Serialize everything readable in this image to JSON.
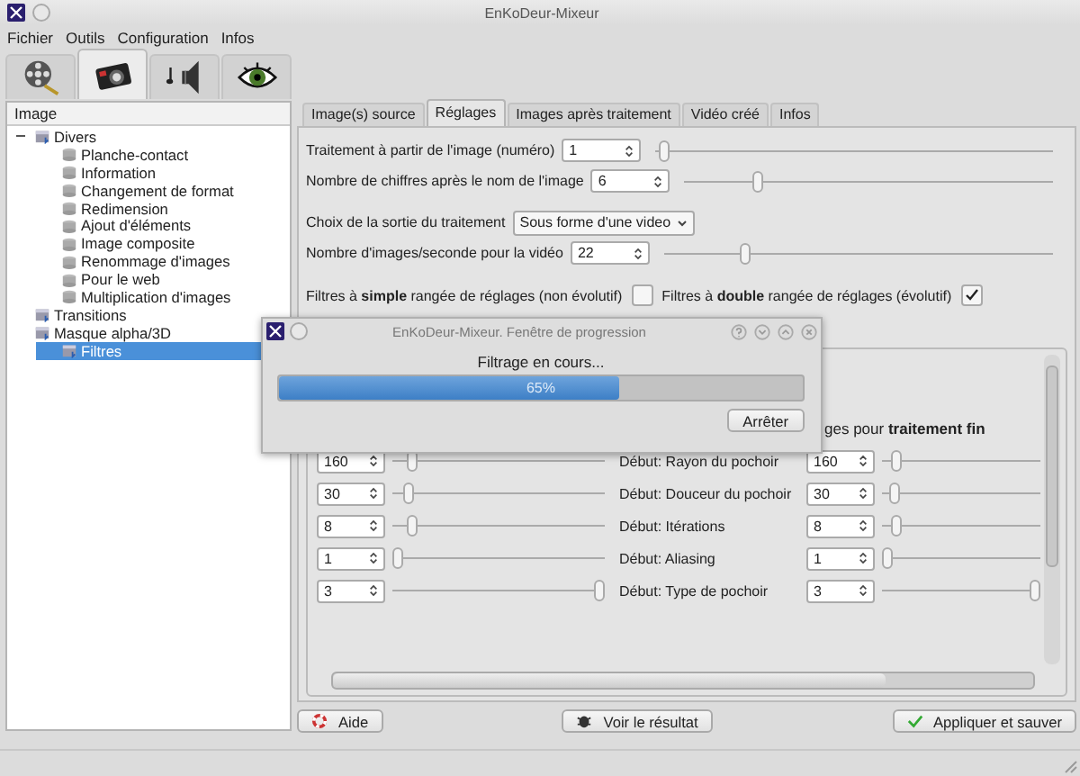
{
  "window": {
    "title": "EnKoDeur-Mixeur"
  },
  "menu": [
    "Fichier",
    "Outils",
    "Configuration",
    "Infos"
  ],
  "toolbar_tabs": [
    {
      "kind": "film",
      "selected": false
    },
    {
      "kind": "camera",
      "selected": true
    },
    {
      "kind": "speaker",
      "selected": false
    },
    {
      "kind": "eye",
      "selected": false
    }
  ],
  "sidebar": {
    "header": "Image",
    "tree": [
      {
        "label": "Divers",
        "expanded": true,
        "selected": false,
        "children": [
          {
            "label": "Planche-contact",
            "selected": false
          },
          {
            "label": "Information",
            "selected": false
          },
          {
            "label": "Changement de format",
            "selected": false
          },
          {
            "label": "Redimension",
            "selected": false
          },
          {
            "label": "Ajout d'éléments",
            "selected": false
          },
          {
            "label": "Image composite",
            "selected": false
          },
          {
            "label": "Renommage d'images",
            "selected": false
          },
          {
            "label": "Pour le web",
            "selected": false
          },
          {
            "label": "Multiplication d'images",
            "selected": false
          }
        ]
      },
      {
        "label": "Transitions",
        "selected": false
      },
      {
        "label": "Masque alpha/3D",
        "selected": false
      },
      {
        "label": "Filtres",
        "selected": true
      }
    ]
  },
  "tabs": [
    {
      "label": "Image(s) source",
      "selected": false
    },
    {
      "label": "Réglages",
      "selected": true
    },
    {
      "label": "Images après traitement",
      "selected": false
    },
    {
      "label": "Vidéo créé",
      "selected": false
    },
    {
      "label": "Infos",
      "selected": false
    }
  ],
  "settings": [
    {
      "kind": "spin",
      "label": "Traitement à partir de l'image (numéro)",
      "value": "1",
      "level": 0.01
    },
    {
      "kind": "spin",
      "label": "Nombre de chiffres après le nom de l'image",
      "value": "6",
      "level": 0.19
    },
    {
      "kind": "combo",
      "label": "Choix de la sortie du traitement",
      "value": "Sous forme d'une video"
    },
    {
      "kind": "spin",
      "label": "Nombre d'images/seconde pour la vidéo",
      "value": "22",
      "level": 0.2
    },
    {
      "kind": "checks",
      "items": [
        {
          "label": "Filtres à **simple** rangée de réglages (non évolutif)",
          "checked": false
        },
        {
          "label": "Filtres à **double** rangée de réglages (évolutif)",
          "checked": true
        }
      ]
    }
  ],
  "filter_group": {
    "heading": "ges pour **traitement fin**",
    "rows": [
      {
        "left": {
          "value": "160",
          "level": 0.07
        },
        "label": "Début: Rayon du pochoir",
        "right": {
          "value": "160",
          "level": 0.06
        }
      },
      {
        "left": {
          "value": "30",
          "level": 0.05
        },
        "label": "Début: Douceur du pochoir",
        "right": {
          "value": "30",
          "level": 0.05
        }
      },
      {
        "left": {
          "value": "8",
          "level": 0.07
        },
        "label": "Début: Itérations",
        "right": {
          "value": "8",
          "level": 0.06
        }
      },
      {
        "left": {
          "value": "1",
          "level": 0
        },
        "label": "Début: Aliasing",
        "right": {
          "value": "1",
          "level": 0
        }
      },
      {
        "left": {
          "value": "3",
          "level": 1
        },
        "label": "Début: Type de pochoir",
        "right": {
          "value": "3",
          "level": 1
        }
      }
    ]
  },
  "buttons": [
    {
      "kind": "help",
      "label": "Aide"
    },
    {
      "kind": "view",
      "label": "Voir le résultat"
    },
    {
      "kind": "apply",
      "label": "Appliquer et sauver"
    }
  ],
  "progress_dialog": {
    "title": "EnKoDeur-Mixeur. Fenêtre de progression",
    "message": "Filtrage en cours...",
    "level": 0.65,
    "percent": "65%",
    "button": "Arrêter"
  }
}
